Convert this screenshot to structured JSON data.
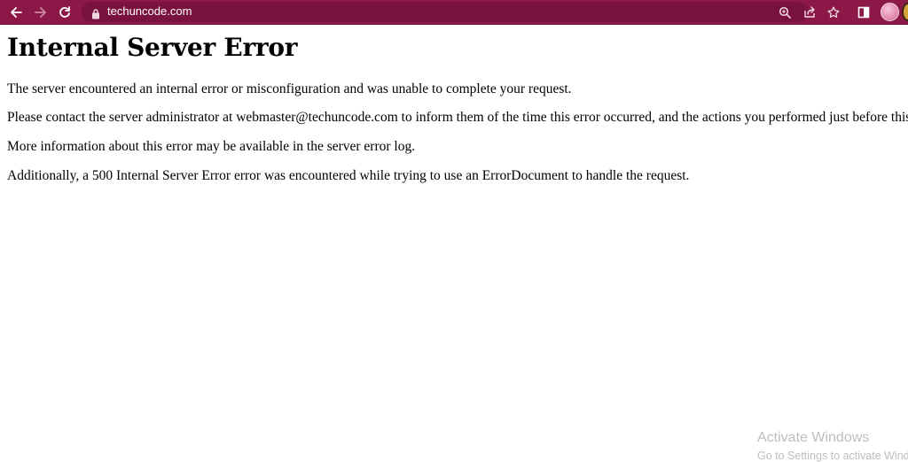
{
  "browser": {
    "url": "techuncode.com",
    "accent": "#8c1848",
    "icons": [
      "back-arrow-icon",
      "forward-arrow-icon",
      "reload-icon",
      "lock-icon",
      "zoom-icon",
      "share-icon",
      "bookmark-star-icon",
      "side-panel-icon",
      "profile-avatar"
    ]
  },
  "page": {
    "title": "Internal Server Error",
    "paragraphs": [
      "The server encountered an internal error or misconfiguration and was unable to complete your request.",
      "Please contact the server administrator at webmaster@techuncode.com to inform them of the time this error occurred, and the actions you performed just before this error.",
      "More information about this error may be available in the server error log.",
      "Additionally, a 500 Internal Server Error error was encountered while trying to use an ErrorDocument to handle the request."
    ]
  },
  "watermark": {
    "title": "Activate Windows",
    "subtitle": "Go to Settings to activate Windows."
  }
}
